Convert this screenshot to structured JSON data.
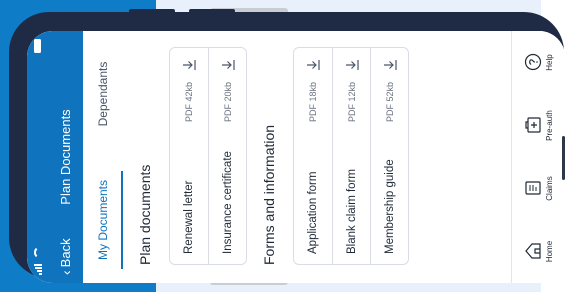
{
  "header": {
    "back_label": "Back",
    "title": "Plan Documents"
  },
  "tabs": [
    {
      "label": "My Documents",
      "active": true
    },
    {
      "label": "Dependants",
      "active": false
    }
  ],
  "sections": [
    {
      "title": "Plan documents",
      "documents": [
        {
          "name": "Renewal letter",
          "meta": "PDF 42kb"
        },
        {
          "name": "Insurance certificate",
          "meta": "PDF 20kb"
        }
      ]
    },
    {
      "title": "Forms and information",
      "documents": [
        {
          "name": "Application form",
          "meta": "PDF 18kb"
        },
        {
          "name": "Blank claim form",
          "meta": "PDF 12kb"
        },
        {
          "name": "Membership guide",
          "meta": "PDF 52kb"
        }
      ]
    }
  ],
  "bottom_nav": [
    {
      "label": "Home",
      "icon": "home-icon"
    },
    {
      "label": "Claims",
      "icon": "claims-icon"
    },
    {
      "label": "Pre-auth",
      "icon": "pre-auth-icon"
    },
    {
      "label": "Help",
      "icon": "help-icon"
    }
  ],
  "colors": {
    "primary": "#0f73bd",
    "frame": "#1f2a44",
    "background_light": "#e8f1fb"
  }
}
